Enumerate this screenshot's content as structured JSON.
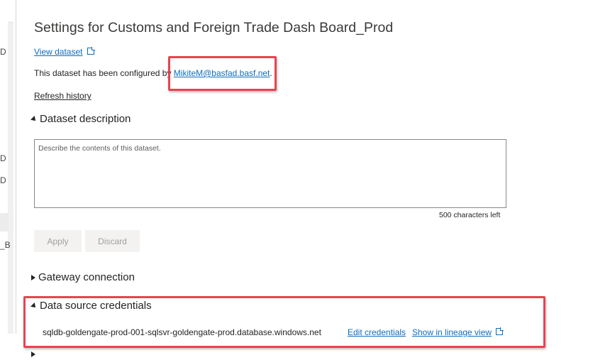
{
  "page": {
    "title": "Settings for Customs and Foreign Trade Dash Board_Prod",
    "view_dataset_label": "View dataset",
    "configured_prefix": "This dataset has been configured by ",
    "configured_email": "MikiteM@basfad.basf.net",
    "configured_suffix": ".",
    "refresh_history_label": "Refresh history"
  },
  "sidebar": {
    "fragments": [
      "D",
      "D",
      "D",
      "_B"
    ]
  },
  "dataset_description": {
    "heading": "Dataset description",
    "placeholder": "Describe the contents of this dataset.",
    "chars_left": "500 characters left",
    "apply_label": "Apply",
    "discard_label": "Discard"
  },
  "gateway_connection": {
    "heading": "Gateway connection"
  },
  "data_source_credentials": {
    "heading": "Data source credentials",
    "source": "sqldb-goldengate-prod-001-sqlsvr-goldengate-prod.database.windows.net",
    "edit_label": "Edit credentials",
    "lineage_label": "Show in lineage view"
  },
  "colors": {
    "link": "#0f6cbd",
    "highlight": "#e8444f",
    "disabled_button_bg": "#f3f2f1"
  }
}
